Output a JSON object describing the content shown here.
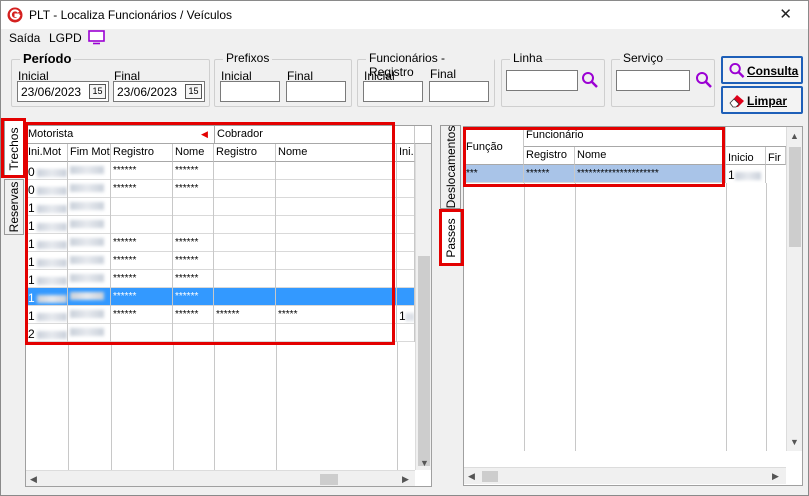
{
  "window": {
    "title": "PLT - Localiza Funcionários / Veículos",
    "close_glyph": "✕"
  },
  "menu": {
    "items": [
      "Saída",
      "LGPD"
    ]
  },
  "periodo": {
    "title": "Período",
    "inicial_label": "Inicial",
    "final_label": "Final",
    "inicial_value": "23/06/2023",
    "final_value": "23/06/2023",
    "cal_glyph": "15"
  },
  "prefixos": {
    "title": "Prefixos",
    "inicial_label": "Inicial",
    "final_label": "Final"
  },
  "func_registro": {
    "title": "Funcionários - Registro",
    "inicial_label": "Inicial",
    "final_label": "Final"
  },
  "linha": {
    "title": "Linha"
  },
  "servico": {
    "title": "Serviço"
  },
  "buttons": {
    "consulta": "Consulta",
    "limpar": "Limpar"
  },
  "left_tabs": {
    "trechos": "Trechos",
    "reservas": "Reservas"
  },
  "mid_tabs": {
    "deslocamentos": "Deslocamentos",
    "passes": "Passes"
  },
  "left_grid": {
    "group_headers": {
      "motorista": "Motorista",
      "cobrador": "Cobrador"
    },
    "columns": [
      "Ini.Mot",
      "Fim Mot",
      "Registro",
      "Nome",
      "Registro",
      "Nome",
      "Ini.("
    ],
    "rows": [
      {
        "ini": "0",
        "reg": "******",
        "nome": "******",
        "creg": "",
        "cnome": "",
        "extra": ""
      },
      {
        "ini": "0",
        "reg": "******",
        "nome": "******",
        "creg": "",
        "cnome": "",
        "extra": ""
      },
      {
        "ini": "1",
        "reg": "",
        "nome": "",
        "creg": "",
        "cnome": "",
        "extra": ""
      },
      {
        "ini": "1",
        "reg": "",
        "nome": "",
        "creg": "",
        "cnome": "",
        "extra": ""
      },
      {
        "ini": "1",
        "reg": "******",
        "nome": "******",
        "creg": "",
        "cnome": "",
        "extra": ""
      },
      {
        "ini": "1",
        "reg": "******",
        "nome": "******",
        "creg": "",
        "cnome": "",
        "extra": ""
      },
      {
        "ini": "1",
        "reg": "******",
        "nome": "******",
        "creg": "",
        "cnome": "",
        "extra": ""
      },
      {
        "ini": "1",
        "reg": "******",
        "nome": "******",
        "creg": "",
        "cnome": "",
        "extra": ""
      },
      {
        "ini": "1",
        "reg": "******",
        "nome": "******",
        "creg": "******",
        "cnome": "*****",
        "extra": "1"
      },
      {
        "ini": "2",
        "reg": "",
        "nome": "",
        "creg": "",
        "cnome": "",
        "extra": ""
      }
    ]
  },
  "right_grid": {
    "funcao_header": "Função",
    "funcionario_header": "Funcionário",
    "columns": [
      "Registro",
      "Nome",
      "Inicio",
      "Fir"
    ],
    "rows": [
      {
        "funcao": "***",
        "registro": "******",
        "nome": "*********************",
        "inicio": "1"
      }
    ]
  },
  "colors": {
    "highlight": "#e30000",
    "selection": "#3399ff",
    "selection_inactive": "#a9c4e8",
    "accent": "#9b00d3"
  }
}
